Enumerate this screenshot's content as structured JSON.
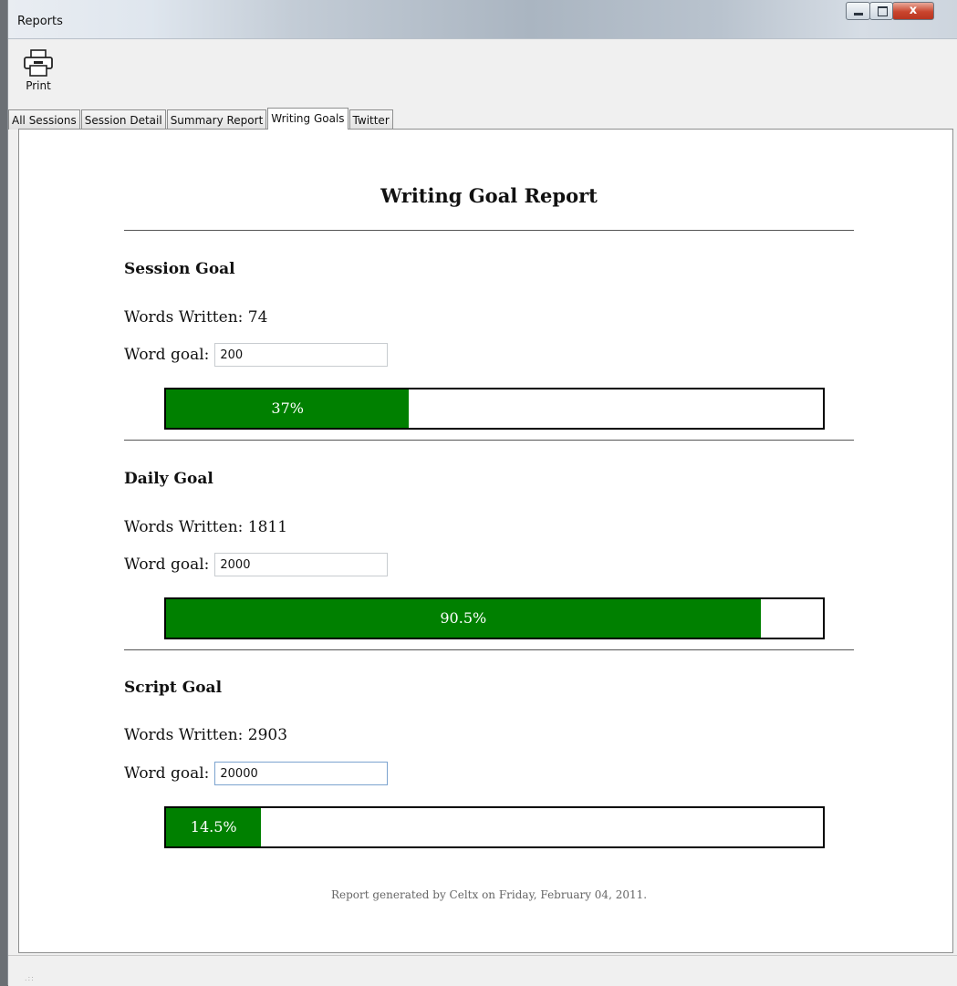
{
  "window": {
    "title": "Reports",
    "controls": {
      "minimize": "minimize",
      "maximize": "maximize",
      "close": "x"
    }
  },
  "toolbar": {
    "print_label": "Print",
    "print_icon": "printer-icon"
  },
  "tabs": [
    {
      "label": "All Sessions",
      "active": false
    },
    {
      "label": "Session Detail",
      "active": false
    },
    {
      "label": "Summary Report",
      "active": false
    },
    {
      "label": "Writing Goals",
      "active": true
    },
    {
      "label": "Twitter",
      "active": false
    }
  ],
  "report": {
    "title": "Writing Goal Report",
    "footer": "Report generated by Celtx on Friday, February 04, 2011.",
    "goals": [
      {
        "heading": "Session Goal",
        "words_written": "Words Written: 74",
        "goal_label": "Word goal:",
        "goal_value": "200",
        "progress_label": "37%",
        "progress": 0.37
      },
      {
        "heading": "Daily Goal",
        "words_written": "Words Written: 1811",
        "goal_label": "Word goal:",
        "goal_value": "2000",
        "progress_label": "90.5%",
        "progress": 0.905
      },
      {
        "heading": "Script Goal",
        "words_written": "Words Written: 2903",
        "goal_label": "Word goal:",
        "goal_value": "20000",
        "progress_label": "14.5%",
        "progress": 0.145
      }
    ]
  },
  "colors": {
    "progress_fill": "#008000",
    "progress_border": "#000000"
  }
}
